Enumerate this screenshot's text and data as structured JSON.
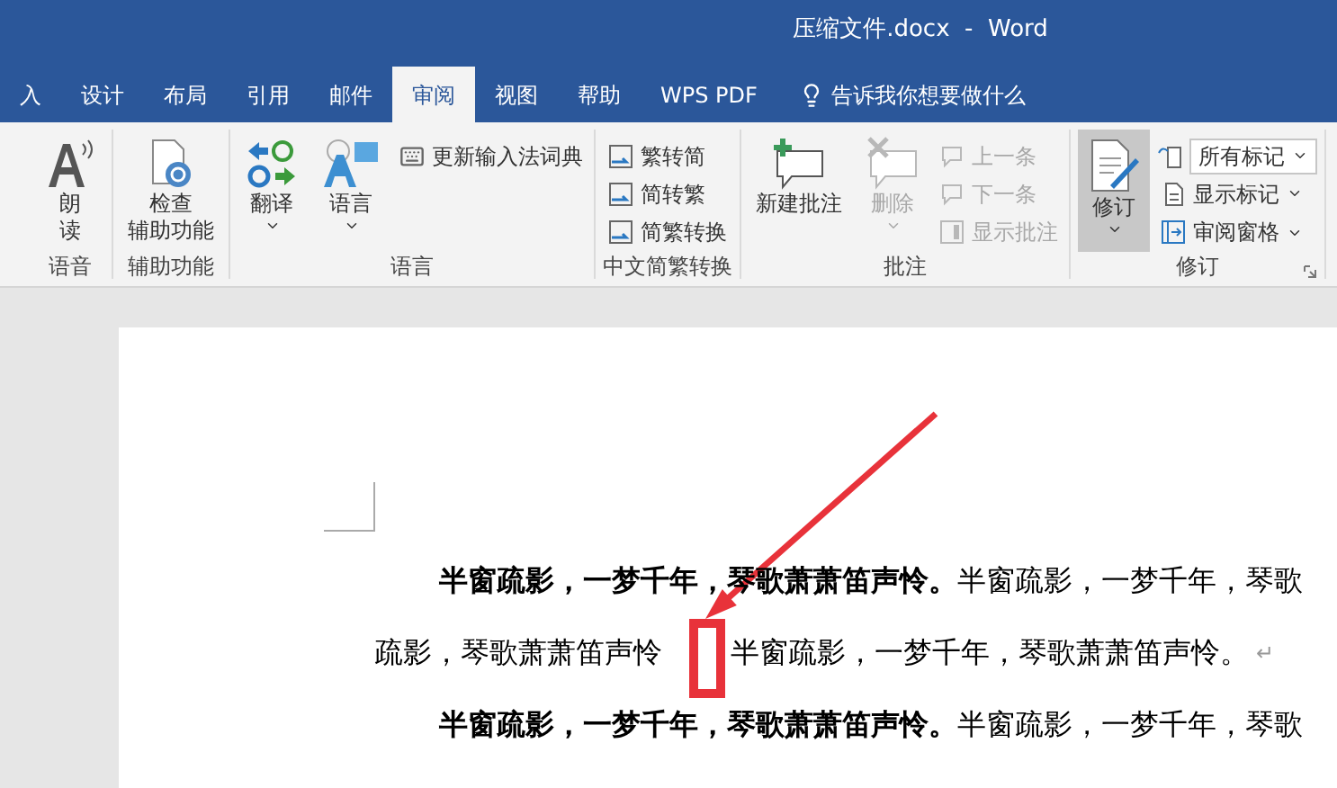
{
  "window": {
    "title": "压缩文件.docx  -  Word"
  },
  "tabs": [
    {
      "label": "入",
      "selected": false
    },
    {
      "label": "设计",
      "selected": false
    },
    {
      "label": "布局",
      "selected": false
    },
    {
      "label": "引用",
      "selected": false
    },
    {
      "label": "邮件",
      "selected": false
    },
    {
      "label": "审阅",
      "selected": true
    },
    {
      "label": "视图",
      "selected": false
    },
    {
      "label": "帮助",
      "selected": false
    },
    {
      "label": "WPS PDF",
      "selected": false
    }
  ],
  "tell_me": {
    "placeholder": "告诉我你想要做什么"
  },
  "ribbon": {
    "groups": [
      {
        "label": "语音",
        "buttons": [
          {
            "kind": "large",
            "label": "朗读",
            "disabled": false,
            "selected": false
          }
        ]
      },
      {
        "label": "辅助功能",
        "buttons": [
          {
            "kind": "large",
            "label": "检查",
            "label_2": "辅助功能",
            "disabled": false,
            "selected": false
          }
        ]
      },
      {
        "label": "语言",
        "buttons": [
          {
            "kind": "large",
            "label": "翻译",
            "dropdown": true,
            "disabled": false,
            "selected": false
          },
          {
            "kind": "large",
            "label": "语言",
            "dropdown": true,
            "disabled": false,
            "selected": false
          },
          {
            "kind": "small",
            "label": "更新输入法词典",
            "disabled": false
          }
        ]
      },
      {
        "label": "中文简繁转换",
        "buttons": [
          {
            "kind": "small",
            "label": "繁转简",
            "disabled": false
          },
          {
            "kind": "small",
            "label": "简转繁",
            "disabled": false
          },
          {
            "kind": "small",
            "label": "简繁转换",
            "disabled": false
          }
        ]
      },
      {
        "label": "批注",
        "buttons": [
          {
            "kind": "large",
            "label": "新建批注",
            "disabled": false,
            "selected": false
          },
          {
            "kind": "large",
            "label": "删除",
            "dropdown": true,
            "disabled": true,
            "selected": false
          },
          {
            "kind": "small",
            "label": "上一条",
            "disabled": true
          },
          {
            "kind": "small",
            "label": "下一条",
            "disabled": true
          },
          {
            "kind": "small",
            "label": "显示批注",
            "disabled": true
          }
        ]
      },
      {
        "label": "修订",
        "launcher": true,
        "buttons": [
          {
            "kind": "large",
            "label": "修订",
            "dropdown": true,
            "disabled": false,
            "selected": true
          },
          {
            "kind": "select",
            "label": "所有标记",
            "disabled": false
          },
          {
            "kind": "small",
            "label": "显示标记",
            "dropdown": true,
            "disabled": false
          },
          {
            "kind": "small",
            "label": "审阅窗格",
            "dropdown": true,
            "disabled": false
          }
        ]
      }
    ]
  },
  "document": {
    "paragraphs": [
      {
        "lead": "半窗疏影，一梦千年，琴歌萧萧笛声怜。",
        "line_1": "半窗疏影，一梦千年，琴歌",
        "line_2": "疏影，琴歌萧萧笛声怜",
        "line_2_after": "半窗疏影，一梦千年，琴歌萧萧笛声怜。",
        "mark": "↵"
      },
      {
        "lead": "半窗疏影，一梦千年，琴歌萧萧笛声怜。",
        "line_1": "半窗疏影，一梦千年，琴歌"
      }
    ]
  }
}
